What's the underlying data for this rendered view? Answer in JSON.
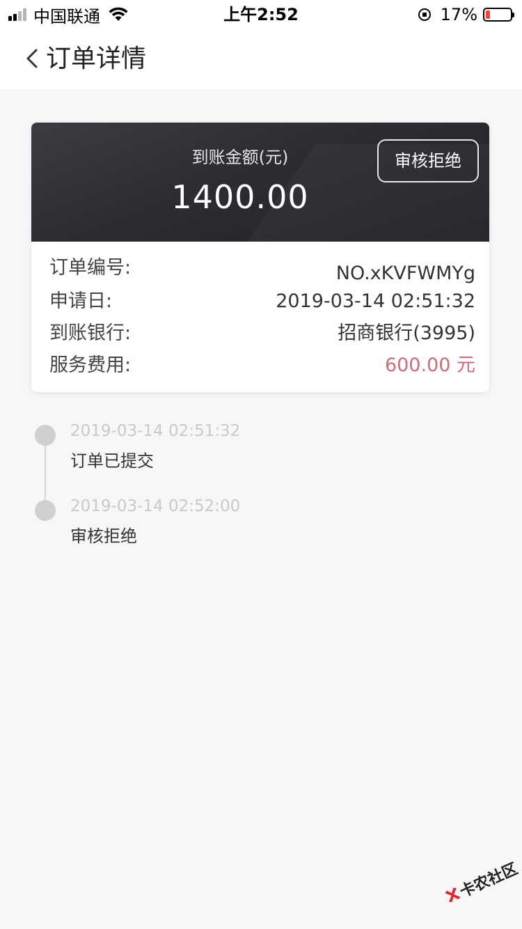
{
  "status_bar": {
    "carrier": "中国联通",
    "time": "上午2:52",
    "battery_percent": "17%",
    "battery_level": 0.17,
    "battery_color": "#ff3b30",
    "icons": [
      "signal-icon",
      "wifi-icon",
      "rotation-lock-icon",
      "battery-icon"
    ]
  },
  "nav": {
    "back_icon": "chevron-left-icon",
    "title": "订单详情"
  },
  "summary": {
    "amount_label": "到账金额(元)",
    "amount": "1400.00",
    "status_button": "审核拒绝"
  },
  "details": {
    "order_no_label": "订单编号:",
    "order_no": "NO.xKVFWMYg",
    "apply_date_label": "申请日:",
    "apply_date": "2019-03-14 02:51:32",
    "bank_label": "到账银行:",
    "bank": "招商银行(3995)",
    "fee_label": "服务费用:",
    "fee": "600.00 元",
    "fee_color": "#cc6d77"
  },
  "timeline": [
    {
      "time": "2019-03-14 02:51:32",
      "text": "订单已提交"
    },
    {
      "time": "2019-03-14 02:52:00",
      "text": "审核拒绝"
    }
  ],
  "watermark": {
    "text": "卡农社区"
  }
}
